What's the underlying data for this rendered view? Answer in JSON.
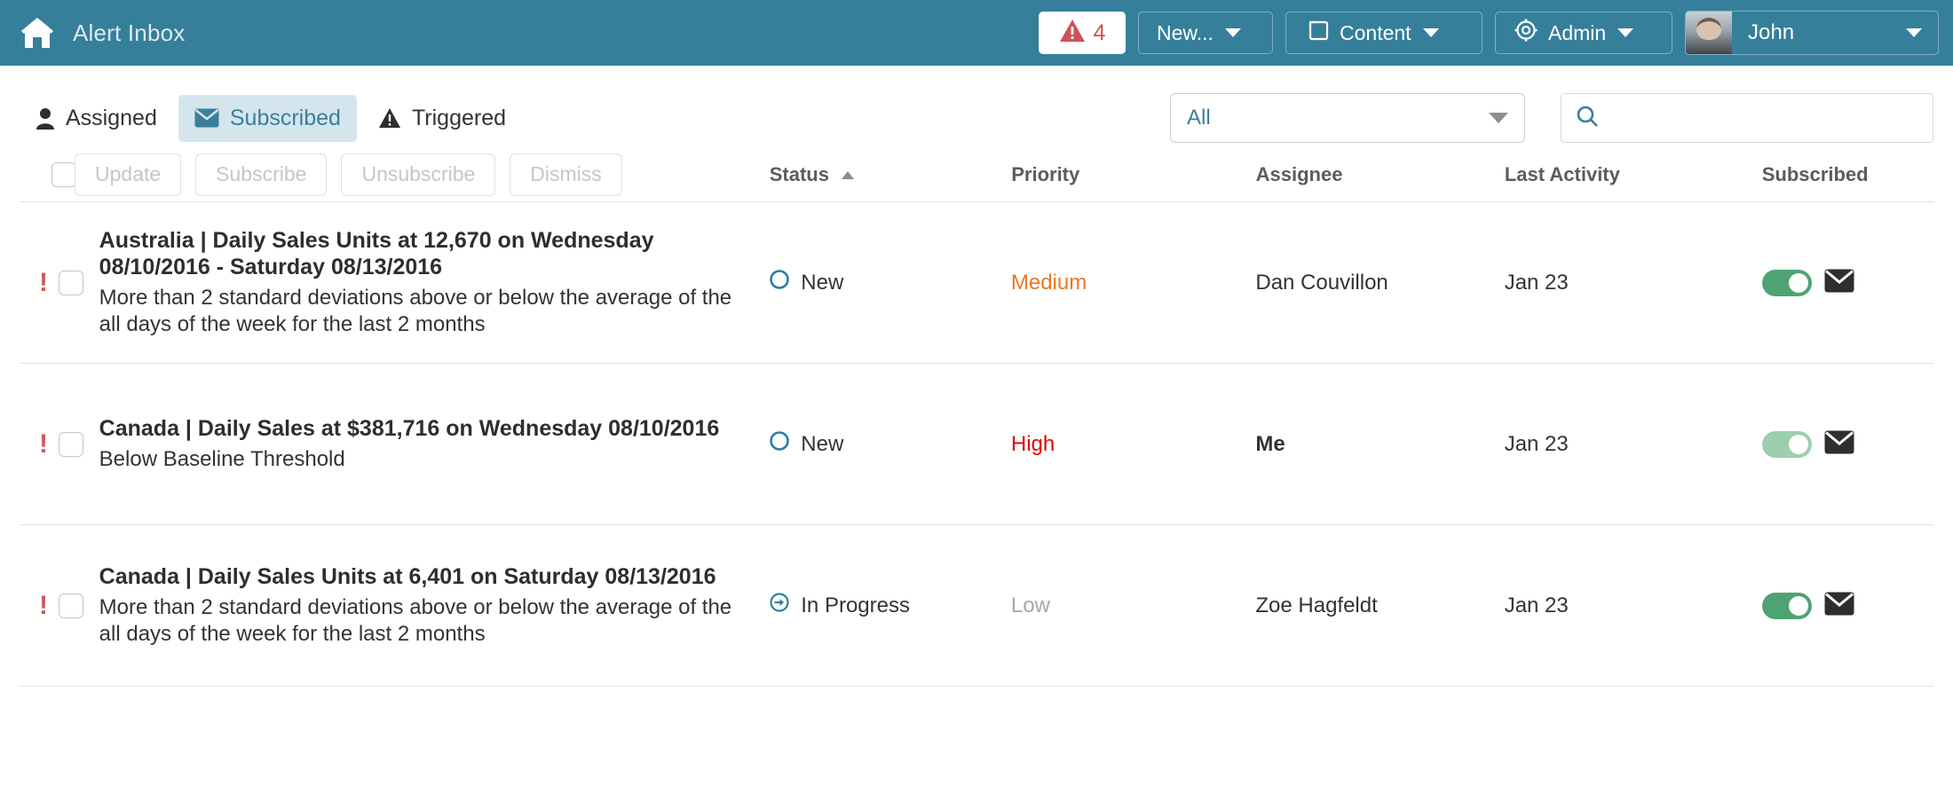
{
  "topbar": {
    "home_icon": "home-icon",
    "title": "Alert Inbox",
    "alerts": {
      "icon": "warning-triangle-icon",
      "count": "4"
    },
    "new_button": {
      "label": "New...",
      "icon": "chevron-down-icon"
    },
    "content_button": {
      "label": "Content",
      "icon": "folder-icon"
    },
    "admin_button": {
      "label": "Admin",
      "icon": "gear-icon"
    },
    "user": {
      "name": "John",
      "avatar": "user-avatar",
      "icon": "chevron-down-icon"
    }
  },
  "tabs": [
    {
      "label": "Assigned",
      "icon": "person-icon",
      "active": false
    },
    {
      "label": "Subscribed",
      "icon": "envelope-icon",
      "active": true
    },
    {
      "label": "Triggered",
      "icon": "warning-triangle-icon",
      "active": false
    }
  ],
  "filter": {
    "select_value": "All",
    "search_value": "",
    "search_placeholder": "",
    "search_icon": "search-icon"
  },
  "toolbar": {
    "update_label": "Update",
    "subscribe_label": "Subscribe",
    "unsubscribe_label": "Unsubscribe",
    "dismiss_label": "Dismiss"
  },
  "columns": {
    "status": "Status",
    "priority": "Priority",
    "assignee": "Assignee",
    "last_activity": "Last Activity",
    "subscribed": "Subscribed",
    "sort_column": "Status",
    "sort_direction": "ascending"
  },
  "rows": [
    {
      "flag": "!",
      "title": "Australia | Daily Sales Units at 12,670 on Wednesday 08/10/2016 - Saturday 08/13/2016",
      "description": "More than 2 standard deviations above or below the average of the all days of the week for the last 2 months",
      "status": "New",
      "status_icon": "circle-outline-icon",
      "priority": "Medium",
      "assignee": "Dan Couvillon",
      "last_activity": "Jan 23",
      "subscribed": true,
      "toggle_state": "on",
      "envelope_icon": "envelope-icon"
    },
    {
      "flag": "!",
      "title": "Canada | Daily Sales at $381,716 on Wednesday 08/10/2016",
      "description": "Below Baseline Threshold",
      "status": "New",
      "status_icon": "circle-outline-icon",
      "priority": "High",
      "assignee": "Me",
      "last_activity": "Jan 23",
      "subscribed": true,
      "toggle_state": "dim",
      "envelope_icon": "envelope-icon"
    },
    {
      "flag": "!",
      "title": "Canada | Daily Sales Units at 6,401 on Saturday 08/13/2016",
      "description": "More than 2 standard deviations above or below the average of the all days of the week for the last 2 months",
      "status": "In Progress",
      "status_icon": "circle-arrow-right-icon",
      "priority": "Low",
      "assignee": "Zoe Hagfeldt",
      "last_activity": "Jan 23",
      "subscribed": true,
      "toggle_state": "on",
      "envelope_icon": "envelope-icon"
    }
  ],
  "colors": {
    "header_teal": "#357f9b",
    "accent_blue": "#3b7f9c",
    "tab_active_bg": "#d4e5ed",
    "priority_medium": "#e87722",
    "priority_high": "#e00000",
    "priority_low": "#a9a9a9",
    "toggle_on": "#4fa373",
    "toggle_dim": "#9ccfae",
    "flag_red": "#cf5a5a"
  }
}
